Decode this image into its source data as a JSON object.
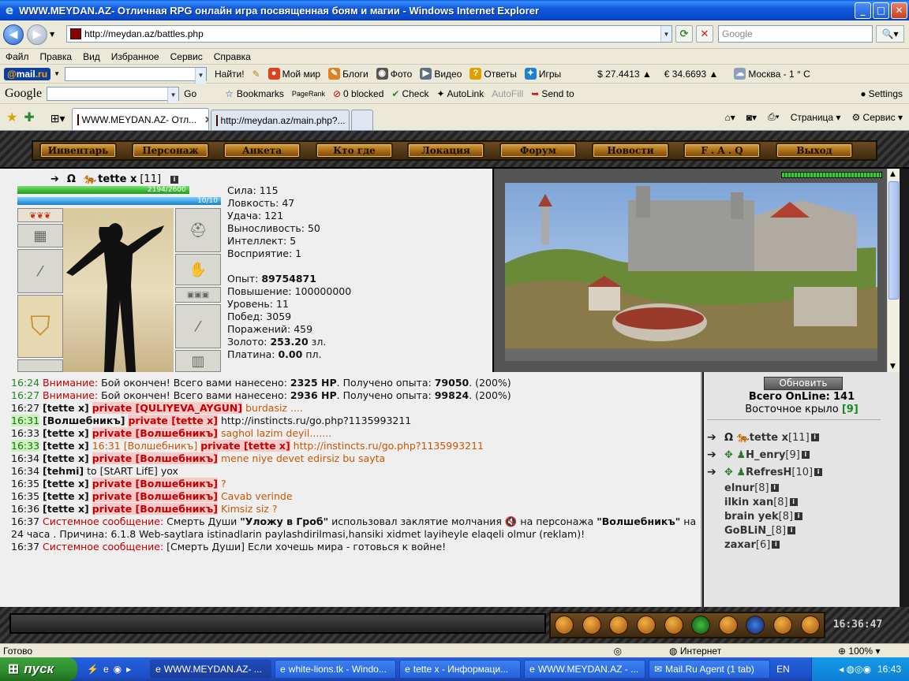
{
  "window": {
    "title": "WWW.MEYDAN.AZ- Отличная RPG онлайн игра посвященная боям и магии - Windows Internet Explorer"
  },
  "address": {
    "url": "http://meydan.az/battles.php",
    "search_placeholder": "Google"
  },
  "menu": [
    "Файл",
    "Правка",
    "Вид",
    "Избранное",
    "Сервис",
    "Справка"
  ],
  "mailru_toolbar": {
    "logo_at": "@",
    "logo_name": "mail",
    "logo_dot": ".ru",
    "find": "Найти!",
    "items": [
      "Мой мир",
      "Блоги",
      "Фото",
      "Видео",
      "Ответы",
      "Игры"
    ],
    "usd": "$ 27.4413 ▲",
    "eur": "€ 34.6693 ▲",
    "weather": "Москва - 1 ° C"
  },
  "google_toolbar": {
    "logo": "Google",
    "go": "Go",
    "bookmarks": "Bookmarks",
    "pagerank": "PageRank",
    "blocked": "0 blocked",
    "check": "Check",
    "autolink": "AutoLink",
    "autofill": "AutoFill",
    "sendto": "Send to",
    "settings": "Settings"
  },
  "tabs": [
    {
      "label": "WWW.MEYDAN.AZ- Отл...",
      "active": true
    },
    {
      "label": "http://meydan.az/main.php?...",
      "active": false
    }
  ],
  "right_tools": {
    "page": "Страница",
    "service": "Сервис"
  },
  "game_nav": [
    "Инвентарь",
    "Персонаж",
    "Анкета",
    "Кто где",
    "Локация",
    "Форум",
    "Новости",
    "F . A . Q",
    "Выход"
  ],
  "character": {
    "name": "tette x",
    "level": "[11]",
    "hp": "2194/2600",
    "hp_fraction": 0.844,
    "mp": "10/10",
    "mp_fraction": 1.0,
    "stats": [
      {
        "label": "Сила:",
        "value": "115"
      },
      {
        "label": "Ловкость:",
        "value": "47"
      },
      {
        "label": "Удача:",
        "value": "121"
      },
      {
        "label": "Выносливость:",
        "value": "50"
      },
      {
        "label": "Интеллект:",
        "value": "5"
      },
      {
        "label": "Восприятие:",
        "value": "1"
      }
    ],
    "exp_label": "Опыт:",
    "exp": "89754871",
    "next_label": "Повышение:",
    "next": "100000000",
    "level_label": "Уровень:",
    "level_value": "11",
    "wins_label": "Побед:",
    "wins": "3059",
    "losses_label": "Поражений:",
    "losses": "459",
    "gold_label": "Золото:",
    "gold": "253.20",
    "gold_unit": "зл.",
    "plat_label": "Платина:",
    "plat": "0.00",
    "plat_unit": "пл."
  },
  "chat": [
    {
      "time": "16:24",
      "time_style": "green",
      "parts": [
        {
          "t": "Внимание:",
          "s": "red"
        },
        {
          "t": " Бой окончен! Всего вами нанесено: "
        },
        {
          "t": "2325 HP",
          "s": "b"
        },
        {
          "t": ". Получено опыта: "
        },
        {
          "t": "79050",
          "s": "b"
        },
        {
          "t": ". (200%)"
        }
      ]
    },
    {
      "time": "16:27",
      "time_style": "green",
      "parts": [
        {
          "t": "Внимание:",
          "s": "red"
        },
        {
          "t": " Бой окончен! Всего вами нанесено: "
        },
        {
          "t": "2936 HP",
          "s": "b"
        },
        {
          "t": ". Получено опыта: "
        },
        {
          "t": "99824",
          "s": "b"
        },
        {
          "t": ". (200%)"
        }
      ]
    },
    {
      "time": "16:27",
      "time_style": "",
      "parts": [
        {
          "t": "[tette x]",
          "s": "b"
        },
        {
          "t": " "
        },
        {
          "t": "private [QULIYEVA_AYGUN]",
          "s": "redb"
        },
        {
          "t": " burdasiz ....",
          "s": "orange"
        }
      ]
    },
    {
      "time": "16:31",
      "time_style": "greenbg",
      "parts": [
        {
          "t": "[Волшебникъ]",
          "s": "b"
        },
        {
          "t": " "
        },
        {
          "t": "private [tette x]",
          "s": "redb"
        },
        {
          "t": " http://instincts.ru/go.php?1135993211"
        }
      ]
    },
    {
      "time": "16:33",
      "time_style": "",
      "parts": [
        {
          "t": "[tette x]",
          "s": "b"
        },
        {
          "t": " "
        },
        {
          "t": "private [Волшебникъ]",
          "s": "redb"
        },
        {
          "t": " saghol lazim deyil.......",
          "s": "orange"
        }
      ]
    },
    {
      "time": "16:33",
      "time_style": "greenbg",
      "parts": [
        {
          "t": "[tette x]",
          "s": "b"
        },
        {
          "t": " 16:31 [Волшебникъ] ",
          "s": "orange"
        },
        {
          "t": "private [tette x]",
          "s": "redb"
        },
        {
          "t": " http://instincts.ru/go.php?1135993211",
          "s": "orange"
        }
      ]
    },
    {
      "time": "16:34",
      "time_style": "",
      "parts": [
        {
          "t": "[tette x]",
          "s": "b"
        },
        {
          "t": " "
        },
        {
          "t": "private [Волшебникъ]",
          "s": "redb"
        },
        {
          "t": " mene niye devet edirsiz bu sayta",
          "s": "orange"
        }
      ]
    },
    {
      "time": "16:34",
      "time_style": "",
      "parts": [
        {
          "t": "[tehmi]",
          "s": "b"
        },
        {
          "t": " to [StART LifE] yox"
        }
      ]
    },
    {
      "time": "16:35",
      "time_style": "",
      "parts": [
        {
          "t": "[tette x]",
          "s": "b"
        },
        {
          "t": " "
        },
        {
          "t": "private [Волшебникъ]",
          "s": "redb"
        },
        {
          "t": " ?",
          "s": "orange"
        }
      ]
    },
    {
      "time": "16:35",
      "time_style": "",
      "parts": [
        {
          "t": "[tette x]",
          "s": "b"
        },
        {
          "t": " "
        },
        {
          "t": "private [Волшебникъ]",
          "s": "redb"
        },
        {
          "t": " Cavab verinde",
          "s": "orange"
        }
      ]
    },
    {
      "time": "16:36",
      "time_style": "",
      "parts": [
        {
          "t": "[tette x]",
          "s": "b"
        },
        {
          "t": " "
        },
        {
          "t": "private [Волшебникъ]",
          "s": "redb"
        },
        {
          "t": " Kimsiz siz ?",
          "s": "orange"
        }
      ]
    },
    {
      "time": "16:37",
      "time_style": "",
      "parts": [
        {
          "t": "Системное сообщение:",
          "s": "red"
        },
        {
          "t": " Смерть Души "
        },
        {
          "t": "\"Уложу в Гроб\"",
          "s": "b"
        },
        {
          "t": " использовал заклятие молчания 🔇 на персонажа "
        },
        {
          "t": "\"Волшебникъ\"",
          "s": "b"
        },
        {
          "t": " на 24 часа . Причина: 6.1.8 Web-saytlara istinadlarin paylashdirilmasi,hansiki xidmet layiheyle elaqeli olmur (reklam)!"
        }
      ]
    },
    {
      "time": "16:37",
      "time_style": "",
      "parts": [
        {
          "t": "Системное сообщение:",
          "s": "red"
        },
        {
          "t": " [Смерть Души] Если хочешь мира - готовься к войне!"
        }
      ]
    }
  ],
  "online": {
    "refresh": "Обновить",
    "total_label": "Всего OnLine:",
    "total": "141",
    "location": "Восточное крыло",
    "location_count": "[9]",
    "users": [
      {
        "name": "tette x",
        "level": "[11]",
        "icons": "Ω"
      },
      {
        "name": "H_enry",
        "level": "[9]",
        "icons": "✥"
      },
      {
        "name": "RefresH",
        "level": "[10]",
        "icons": "✥"
      },
      {
        "name": "elnur",
        "level": "[8]",
        "icons": ""
      },
      {
        "name": "ilkin xan",
        "level": "[8]",
        "icons": ""
      },
      {
        "name": "brain yek",
        "level": "[8]",
        "icons": ""
      },
      {
        "name": "GoBLiN_",
        "level": "[8]",
        "icons": ""
      },
      {
        "name": "zaxar",
        "level": "[6]",
        "icons": ""
      }
    ]
  },
  "game_clock": "16:36:47",
  "status": {
    "left": "Готово",
    "zone": "Интернет",
    "zoom": "100%"
  },
  "taskbar": {
    "start": "пуск",
    "buttons": [
      "WWW.MEYDAN.AZ- ...",
      "white-lions.tk - Windo...",
      "tette x - Информаци...",
      "WWW.MEYDAN.AZ - ...",
      "Mail.Ru Agent (1 tab)"
    ],
    "lang": "EN",
    "clock": "16:43"
  },
  "colors": {
    "accent": "#0a49c8",
    "game_gold": "#d8a23a",
    "alert_red": "#c40000"
  }
}
